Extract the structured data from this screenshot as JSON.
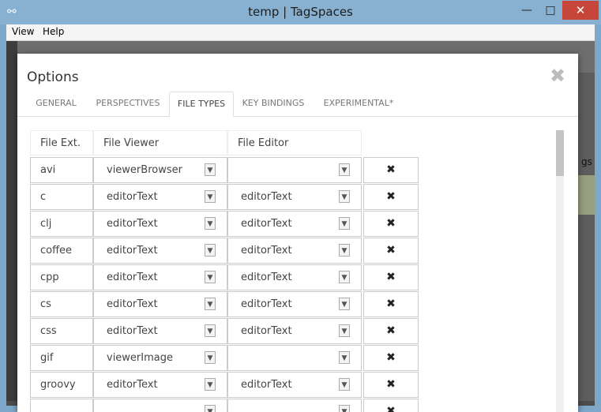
{
  "window": {
    "title": "temp | TagSpaces",
    "minimize": "—",
    "maximize": "□",
    "close": "✕"
  },
  "menu": {
    "view": "View",
    "help": "Help"
  },
  "background": {
    "right_text": "gs"
  },
  "dialog": {
    "title": "Options",
    "close_glyph": "✖",
    "tabs": [
      {
        "label": "GENERAL",
        "active": false
      },
      {
        "label": "PERSPECTIVES",
        "active": false
      },
      {
        "label": "FILE TYPES",
        "active": true
      },
      {
        "label": "KEY BINDINGS",
        "active": false
      },
      {
        "label": "EXPERIMENTAL*",
        "active": false
      }
    ],
    "table": {
      "headers": {
        "ext": "File Ext.",
        "viewer": "File Viewer",
        "editor": "File Editor"
      },
      "delete_glyph": "✖",
      "rows": [
        {
          "ext": "avi",
          "viewer": "viewerBrowser",
          "editor": ""
        },
        {
          "ext": "c",
          "viewer": "editorText",
          "editor": "editorText"
        },
        {
          "ext": "clj",
          "viewer": "editorText",
          "editor": "editorText"
        },
        {
          "ext": "coffee",
          "viewer": "editorText",
          "editor": "editorText"
        },
        {
          "ext": "cpp",
          "viewer": "editorText",
          "editor": "editorText"
        },
        {
          "ext": "cs",
          "viewer": "editorText",
          "editor": "editorText"
        },
        {
          "ext": "css",
          "viewer": "editorText",
          "editor": "editorText"
        },
        {
          "ext": "gif",
          "viewer": "viewerImage",
          "editor": ""
        },
        {
          "ext": "groovy",
          "viewer": "editorText",
          "editor": "editorText"
        },
        {
          "ext": "",
          "viewer": "",
          "editor": ""
        }
      ]
    }
  },
  "icons": {
    "app": "tag-icon",
    "dropdown": "chevron-down-icon",
    "delete": "close-icon"
  }
}
